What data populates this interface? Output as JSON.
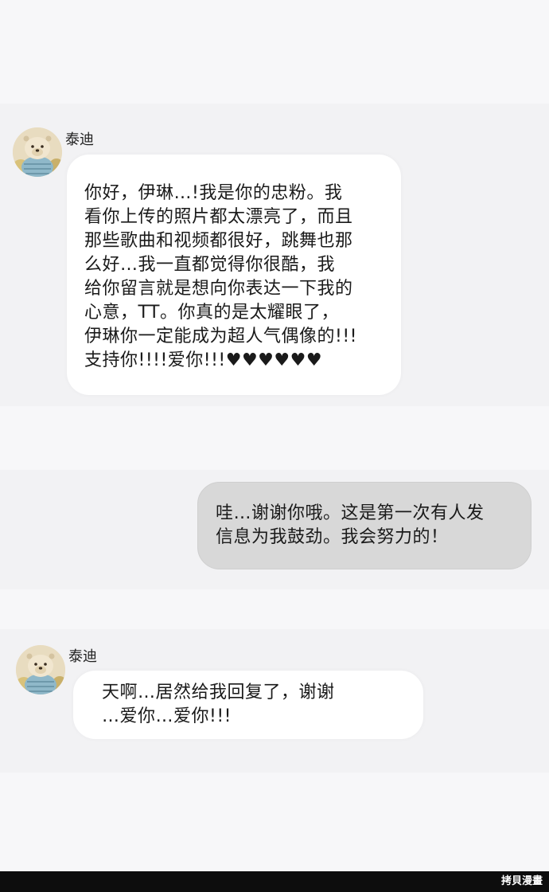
{
  "messages": [
    {
      "direction": "incoming",
      "sender": "泰迪",
      "avatar": "teddy-bear-avatar",
      "lines": [
        "你好，伊琳…!我是你的忠粉。我",
        "看你上传的照片都太漂亮了，而且",
        "那些歌曲和视频都很好，跳舞也那",
        "么好…我一直都觉得你很酷，我",
        "给你留言就是想向你表达一下我的",
        "心意，TT。你真的是太耀眼了，",
        "伊琳你一定能成为超人气偶像的!!!",
        "支持你!!!!爱你!!!♥♥♥♥♥♥"
      ]
    },
    {
      "direction": "outgoing",
      "lines": [
        "哇…谢谢你哦。这是第一次有人发",
        "信息为我鼓劲。我会努力的！"
      ]
    },
    {
      "direction": "incoming",
      "sender": "泰迪",
      "avatar": "teddy-bear-avatar",
      "lines": [
        "天啊…居然给我回复了，谢谢",
        "…爱你…爱你!!!"
      ]
    }
  ],
  "footer": {
    "watermark": "拷貝漫畫"
  },
  "colors": {
    "background": "#f7f7f9",
    "incoming_bubble": "#ffffff",
    "outgoing_bubble": "#d8d8d8",
    "footer_bar": "#0d0d0d"
  }
}
